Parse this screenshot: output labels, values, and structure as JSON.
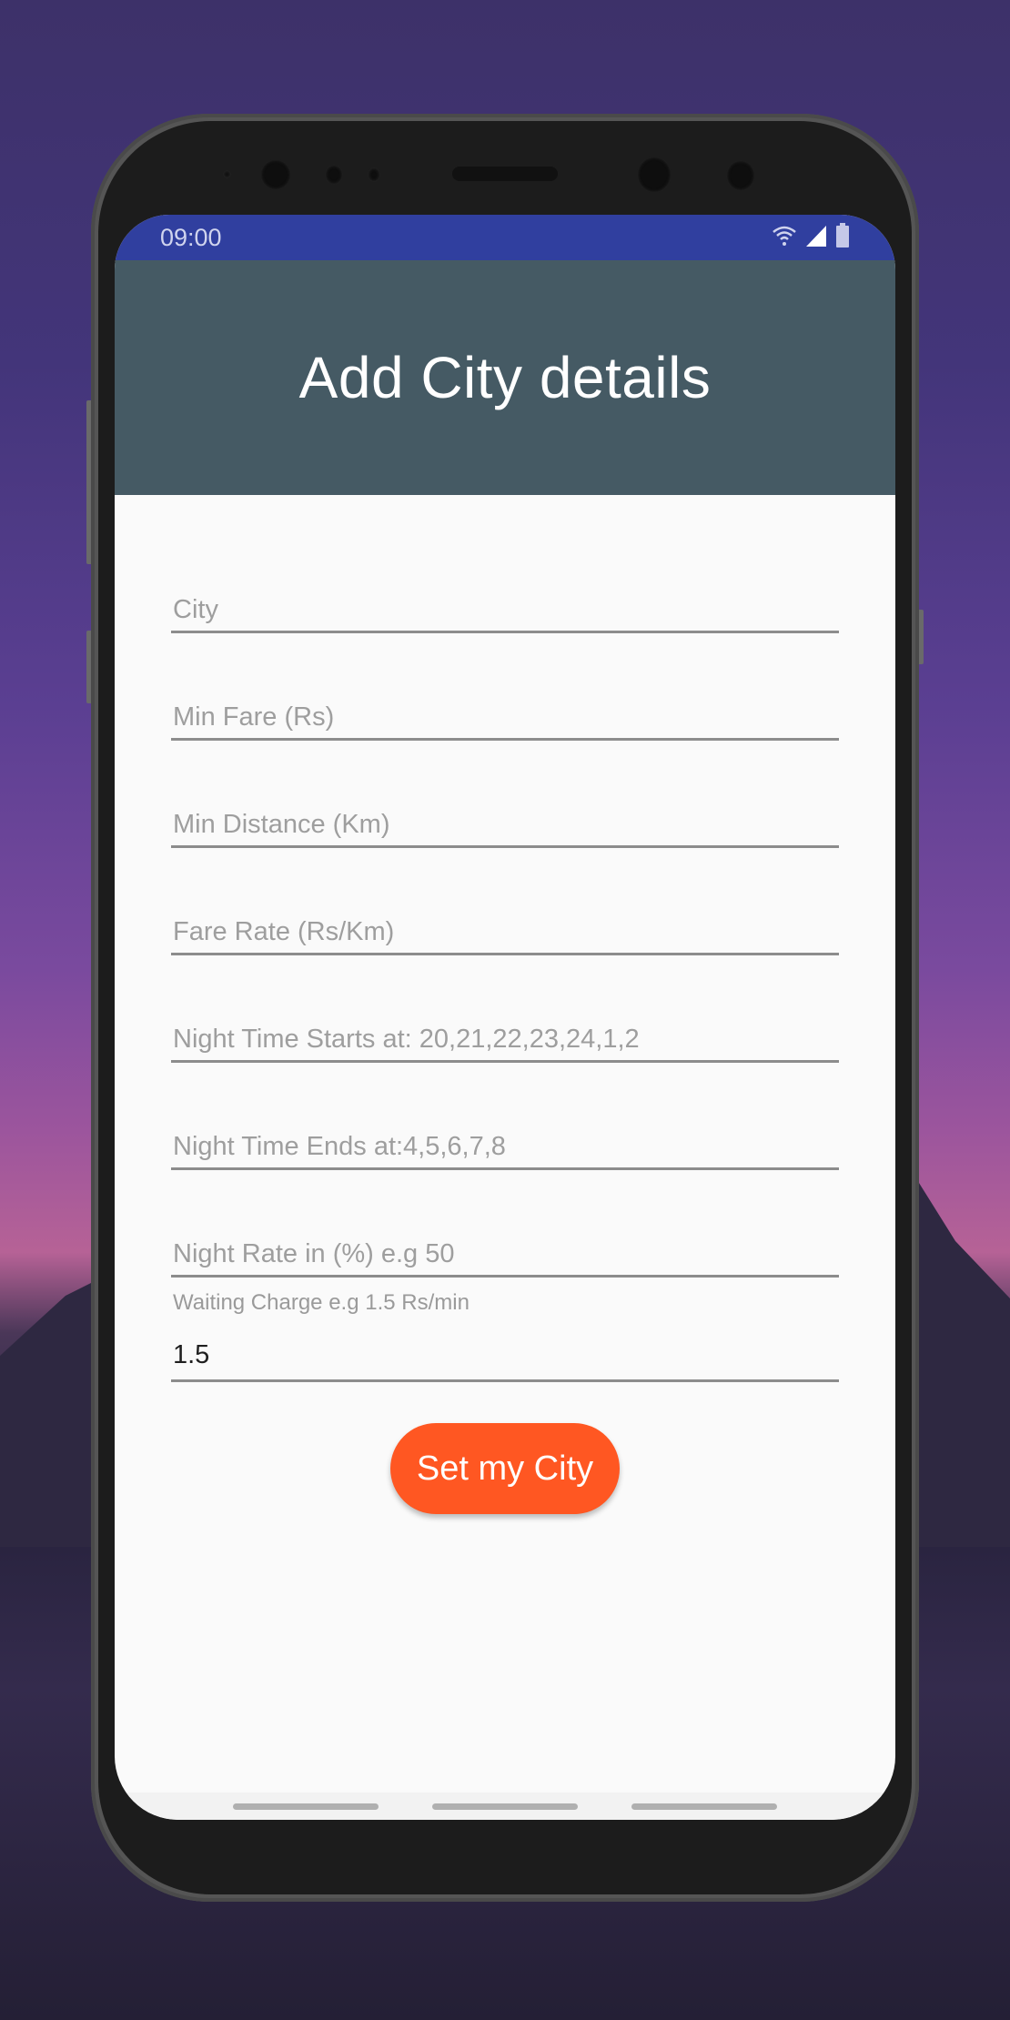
{
  "status_bar": {
    "time": "09:00",
    "icons": [
      "wifi-icon",
      "signal-icon",
      "battery-icon"
    ]
  },
  "header": {
    "title": "Add City details"
  },
  "form": {
    "fields": [
      {
        "placeholder": "City",
        "value": ""
      },
      {
        "placeholder": "Min Fare (Rs)",
        "value": ""
      },
      {
        "placeholder": "Min Distance (Km)",
        "value": ""
      },
      {
        "placeholder": "Fare Rate (Rs/Km)",
        "value": ""
      },
      {
        "placeholder": "Night Time Starts at: 20,21,22,23,24,1,2",
        "value": ""
      },
      {
        "placeholder": "Night Time Ends at:4,5,6,7,8",
        "value": ""
      },
      {
        "placeholder": "Night Rate in (%) e.g 50",
        "value": ""
      }
    ],
    "waiting_charge": {
      "label": "Waiting Charge e.g 1.5 Rs/min",
      "value": "1.5"
    },
    "submit_label": "Set my City"
  },
  "colors": {
    "status_bar": "#303f9f",
    "header": "#455a64",
    "accent_button": "#ff5722",
    "background": "#fafafa"
  },
  "nav_bar": {
    "items": [
      "nav-handle-left",
      "nav-handle-center",
      "nav-handle-right"
    ]
  }
}
